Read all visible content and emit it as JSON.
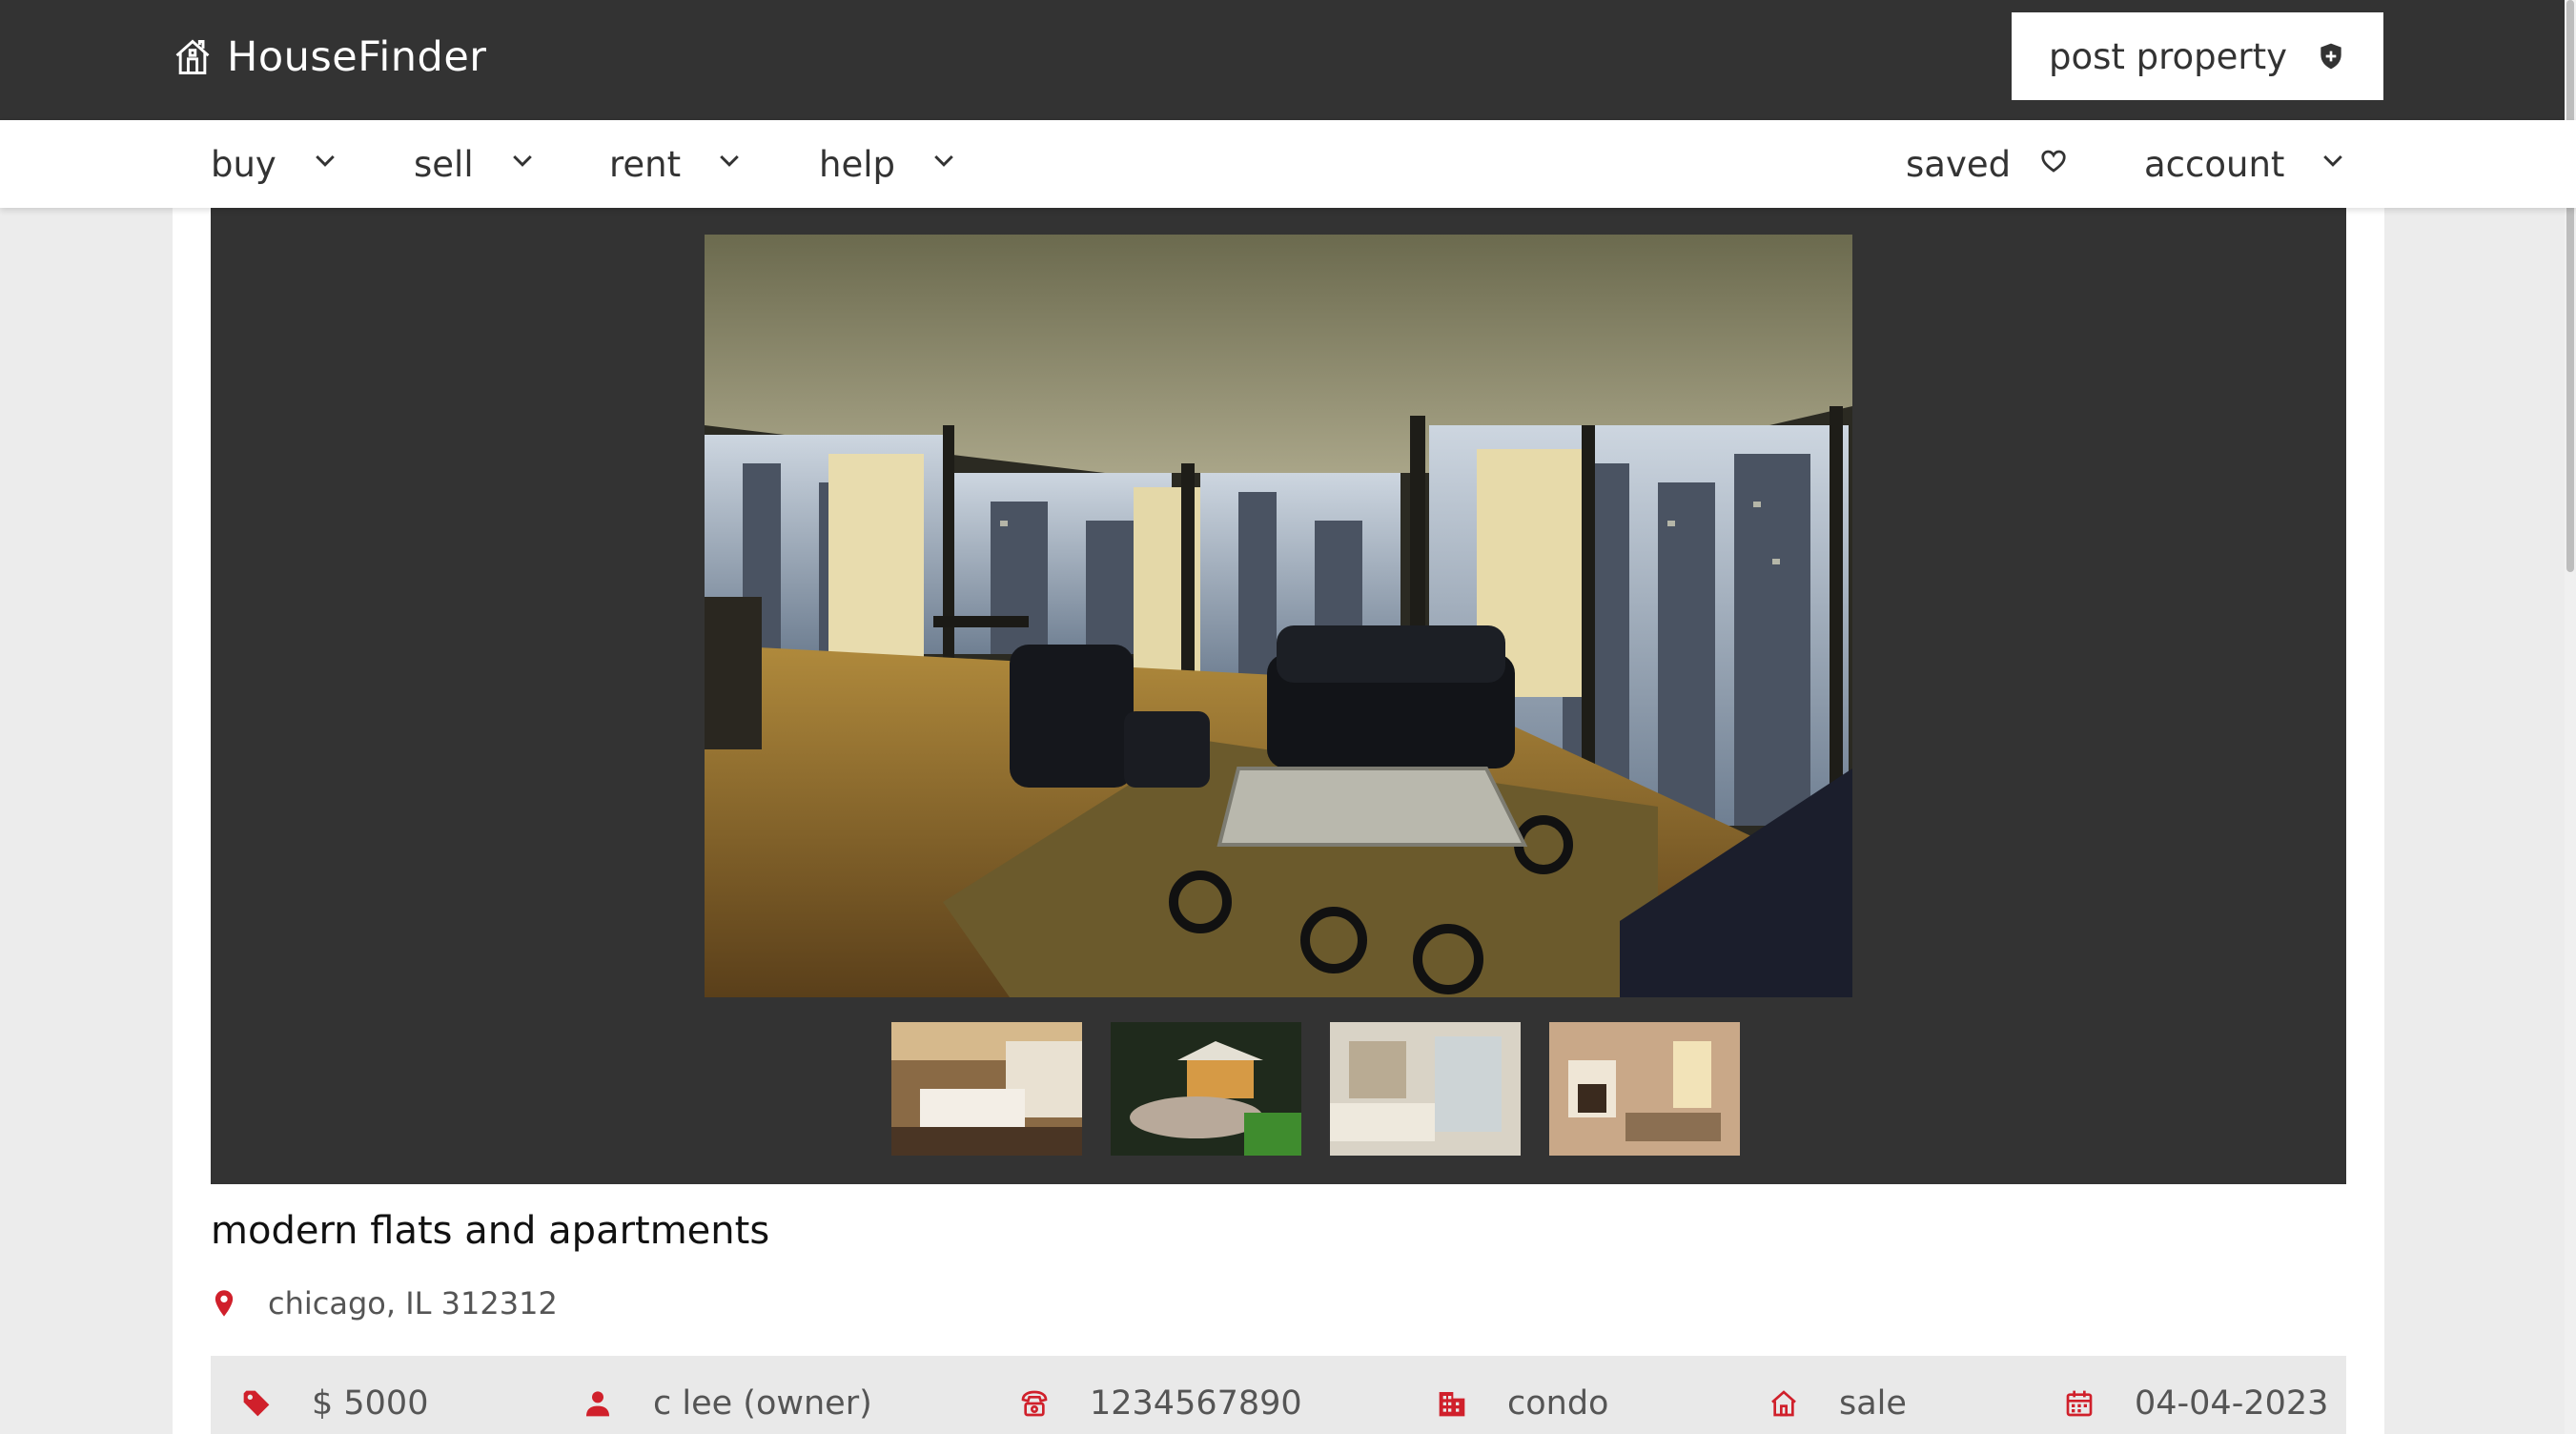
{
  "header": {
    "brand": "HouseFinder",
    "post_property_label": "post property"
  },
  "nav": {
    "items": [
      {
        "label": "buy",
        "icon": "chevron-down-icon"
      },
      {
        "label": "sell",
        "icon": "chevron-down-icon"
      },
      {
        "label": "rent",
        "icon": "chevron-down-icon"
      },
      {
        "label": "help",
        "icon": "chevron-down-icon"
      }
    ],
    "saved_label": "saved",
    "account_label": "account"
  },
  "gallery": {
    "main_photo": "living-room-city-view",
    "thumbnails": [
      "bedroom",
      "garden-gazebo",
      "bathroom",
      "living-room-fireplace"
    ]
  },
  "listing": {
    "title": "modern flats and apartments",
    "location": "chicago, IL 312312",
    "price": "$ 5000",
    "owner": "c lee (owner)",
    "phone": "1234567890",
    "property_type": "condo",
    "listing_type": "sale",
    "date": "04-04-2023"
  },
  "colors": {
    "header_bg": "#333333",
    "accent_red": "#d0202b",
    "gallery_bg": "#333333",
    "info_bar_bg": "#e9e9e9"
  }
}
